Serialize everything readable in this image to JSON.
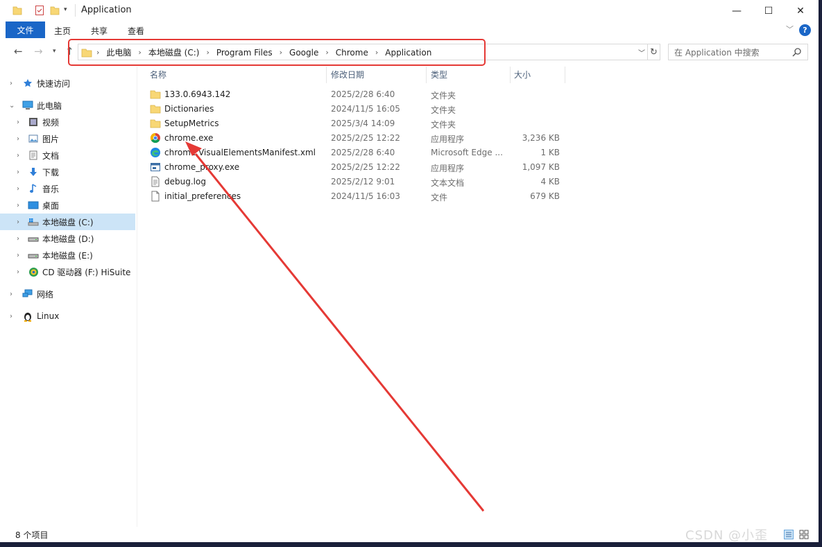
{
  "window": {
    "title": "Application",
    "minimize": "—",
    "maximize": "☐",
    "close": "✕"
  },
  "ribbon": {
    "file_tab": "文件",
    "tabs": [
      "主页",
      "共享",
      "查看"
    ],
    "help": "?"
  },
  "address": {
    "breadcrumbs": [
      "此电脑",
      "本地磁盘 (C:)",
      "Program Files",
      "Google",
      "Chrome",
      "Application"
    ]
  },
  "search": {
    "placeholder": "在 Application 中搜索"
  },
  "sidebar": {
    "items": [
      {
        "label": "快速访问",
        "icon": "star-icon"
      },
      {
        "label": "此电脑",
        "icon": "computer-icon"
      },
      {
        "label": "视频",
        "icon": "video-icon"
      },
      {
        "label": "图片",
        "icon": "picture-icon"
      },
      {
        "label": "文档",
        "icon": "document-icon"
      },
      {
        "label": "下载",
        "icon": "download-icon"
      },
      {
        "label": "音乐",
        "icon": "music-icon"
      },
      {
        "label": "桌面",
        "icon": "desktop-icon"
      },
      {
        "label": "本地磁盘 (C:)",
        "icon": "drive-c-icon"
      },
      {
        "label": "本地磁盘 (D:)",
        "icon": "drive-icon"
      },
      {
        "label": "本地磁盘 (E:)",
        "icon": "drive-icon"
      },
      {
        "label": "CD 驱动器 (F:) HiSuite",
        "icon": "cd-hisuite-icon"
      },
      {
        "label": "网络",
        "icon": "network-icon"
      },
      {
        "label": "Linux",
        "icon": "linux-icon"
      }
    ]
  },
  "columns": {
    "name": "名称",
    "date": "修改日期",
    "type": "类型",
    "size": "大小"
  },
  "files": [
    {
      "name": "133.0.6943.142",
      "date": "2025/2/28 6:40",
      "type": "文件夹",
      "size": "",
      "icon": "folder-icon"
    },
    {
      "name": "Dictionaries",
      "date": "2024/11/5 16:05",
      "type": "文件夹",
      "size": "",
      "icon": "folder-icon"
    },
    {
      "name": "SetupMetrics",
      "date": "2025/3/4 14:09",
      "type": "文件夹",
      "size": "",
      "icon": "folder-icon"
    },
    {
      "name": "chrome.exe",
      "date": "2025/2/25 12:22",
      "type": "应用程序",
      "size": "3,236 KB",
      "icon": "chrome-icon"
    },
    {
      "name": "chrome.VisualElementsManifest.xml",
      "date": "2025/2/28 6:40",
      "type": "Microsoft Edge ...",
      "size": "1 KB",
      "icon": "edge-icon"
    },
    {
      "name": "chrome_proxy.exe",
      "date": "2025/2/25 12:22",
      "type": "应用程序",
      "size": "1,097 KB",
      "icon": "app-icon"
    },
    {
      "name": "debug.log",
      "date": "2025/2/12 9:01",
      "type": "文本文档",
      "size": "4 KB",
      "icon": "text-file-icon"
    },
    {
      "name": "initial_preferences",
      "date": "2024/11/5 16:03",
      "type": "文件",
      "size": "679 KB",
      "icon": "file-icon"
    }
  ],
  "status": {
    "count": "8 个项目"
  },
  "annotation": {
    "color": "#e53935"
  },
  "watermark": "CSDN @小歪"
}
